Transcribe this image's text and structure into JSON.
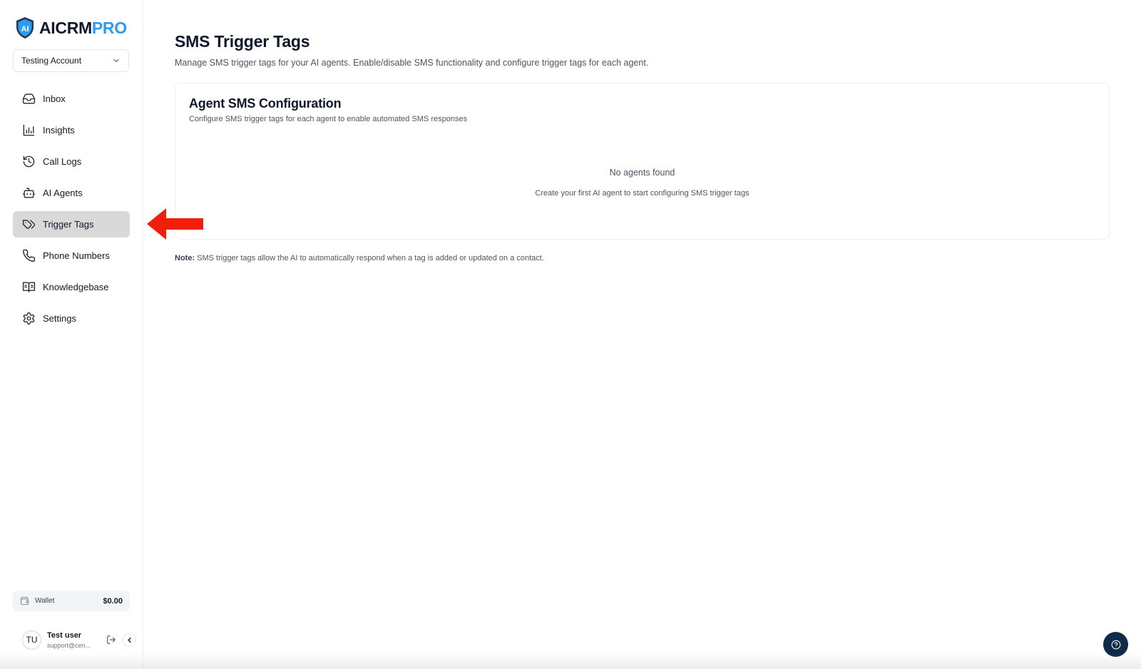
{
  "brand": {
    "name_main": "AICRM",
    "name_accent": "PRO",
    "accent_color": "#2d9cf0"
  },
  "account": {
    "selected": "Testing Account"
  },
  "sidebar": {
    "items": [
      {
        "label": "Inbox",
        "icon": "inbox-icon",
        "active": false
      },
      {
        "label": "Insights",
        "icon": "bar-chart-icon",
        "active": false
      },
      {
        "label": "Call Logs",
        "icon": "history-icon",
        "active": false
      },
      {
        "label": "AI Agents",
        "icon": "bot-icon",
        "active": false
      },
      {
        "label": "Trigger Tags",
        "icon": "tags-icon",
        "active": true
      },
      {
        "label": "Phone Numbers",
        "icon": "phone-icon",
        "active": false
      },
      {
        "label": "Knowledgebase",
        "icon": "book-icon",
        "active": false
      },
      {
        "label": "Settings",
        "icon": "gear-icon",
        "active": false
      }
    ]
  },
  "wallet": {
    "label": "Wallet",
    "amount": "$0.00"
  },
  "user": {
    "initials": "TU",
    "name": "Test user",
    "email": "support@cen..."
  },
  "page": {
    "title": "SMS Trigger Tags",
    "subtitle": "Manage SMS trigger tags for your AI agents. Enable/disable SMS functionality and configure trigger tags for each agent."
  },
  "card": {
    "title": "Agent SMS Configuration",
    "description": "Configure SMS trigger tags for each agent to enable automated SMS responses",
    "empty_title": "No agents found",
    "empty_description": "Create your first AI agent to start configuring SMS trigger tags"
  },
  "note": {
    "label": "Note:",
    "text": " SMS trigger tags allow the AI to automatically respond when a tag is added or updated on a contact."
  },
  "annotation": {
    "arrow_color": "#f01e0a"
  }
}
